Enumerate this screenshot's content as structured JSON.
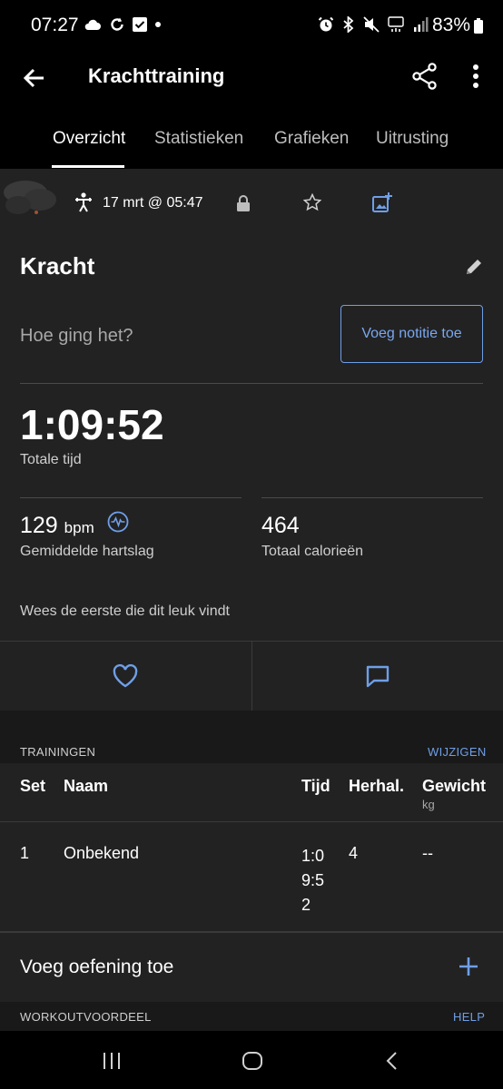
{
  "status_bar": {
    "time": "07:27",
    "battery": "83%"
  },
  "app_bar": {
    "title": "Krachttraining"
  },
  "tabs": [
    {
      "label": "Overzicht",
      "active": true
    },
    {
      "label": "Statistieken",
      "active": false
    },
    {
      "label": "Grafieken",
      "active": false
    },
    {
      "label": "Uitrusting",
      "active": false
    }
  ],
  "activity": {
    "datetime": "17 mrt @ 05:47",
    "title": "Kracht",
    "prompt": "Hoe ging het?",
    "note_button": "Voeg notitie toe",
    "total_time": "1:09:52",
    "total_time_label": "Totale tijd",
    "heart_rate_value": "129",
    "heart_rate_unit": "bpm",
    "heart_rate_label": "Gemiddelde hartslag",
    "calories_value": "464",
    "calories_label": "Totaal calorieën",
    "like_prompt": "Wees de eerste die dit leuk vindt"
  },
  "trainings": {
    "section_title": "TRAININGEN",
    "edit_link": "WIJZIGEN",
    "headers": {
      "set": "Set",
      "name": "Naam",
      "time": "Tijd",
      "reps": "Herhal.",
      "weight": "Gewicht",
      "weight_unit": "kg"
    },
    "rows": [
      {
        "set": "1",
        "name": "Onbekend",
        "time": "1:09:52",
        "reps": "4",
        "weight": "--"
      }
    ],
    "add_exercise": "Voeg oefening toe"
  },
  "advantage": {
    "title": "WORKOUTVOORDEEL",
    "help_link": "HELP"
  },
  "colors": {
    "accent": "#6f9fe6",
    "background": "#222223",
    "band": "#19191a"
  },
  "icons": [
    "back-arrow-icon",
    "share-icon",
    "more-vert-icon",
    "strength-activity-icon",
    "lock-icon",
    "star-icon",
    "add-photo-icon",
    "edit-pencil-icon",
    "heart-rate-icon",
    "heart-icon",
    "comment-icon",
    "plus-icon"
  ]
}
